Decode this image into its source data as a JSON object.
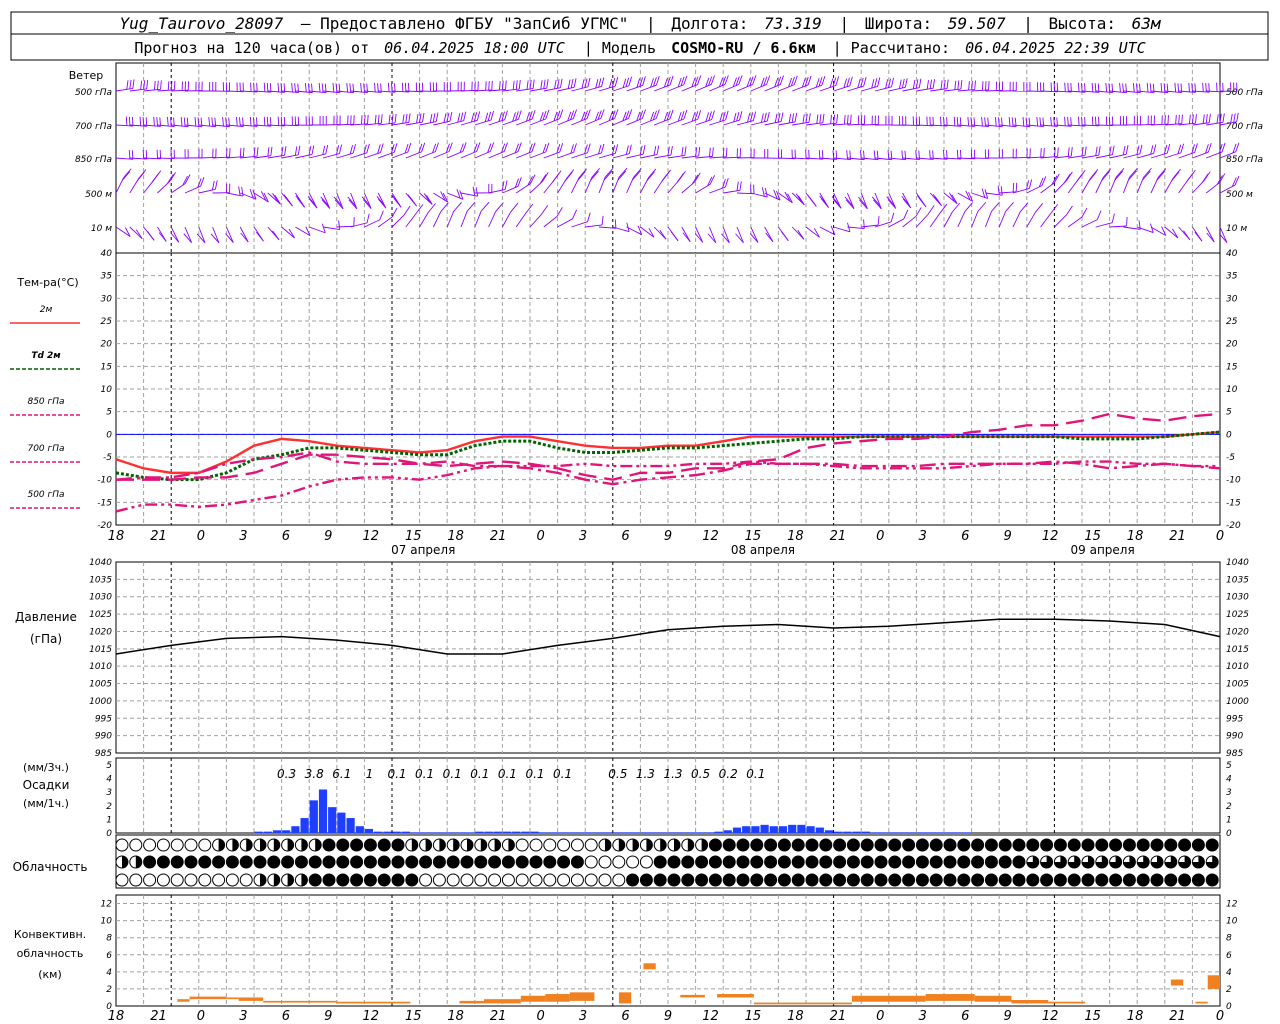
{
  "header": {
    "line1": {
      "station": "Yug_Taurovo_28097",
      "provider": "– Предоставлено ФГБУ \"ЗапСиб УГМС\"",
      "lon_label": "Долгота:",
      "lon": "73.319",
      "lat_label": "Широта:",
      "lat": "59.507",
      "alt_label": "Высота:",
      "alt": "63м"
    },
    "line2": {
      "forecast": "Прогноз на 120 часа(ов) от",
      "run_time": "06.04.2025 18:00 UTC",
      "model_label": "| Модель",
      "model": "COSMO-RU / 6.6км",
      "calc_label": "| Рассчитано:",
      "calc_time": "06.04.2025 22:39 UTC"
    }
  },
  "time_axis": {
    "tick_labels": [
      "18",
      "21",
      "0",
      "3",
      "6",
      "9",
      "12",
      "15",
      "18",
      "21",
      "0",
      "3",
      "6",
      "9",
      "12",
      "15",
      "18",
      "21",
      "0",
      "3",
      "6",
      "9",
      "12",
      "15",
      "18",
      "21",
      "0"
    ],
    "date_labels": [
      {
        "label": "07 апреля",
        "index": 8
      },
      {
        "label": "08 апреля",
        "index": 16
      },
      {
        "label": "09 апреля",
        "index": 24
      }
    ]
  },
  "colors": {
    "t2m": "#ff3030",
    "td2m": "#006400",
    "t850": "#e0157a",
    "wind": "#8b00ff",
    "pressure": "#000000",
    "precip": "#1f3fff",
    "convective": "#f08020",
    "grid": "#a0a0a0",
    "zero": "#0000ff"
  },
  "chart_data": [
    {
      "type": "barbs",
      "title": "Ветер",
      "levels": [
        "500 гПа",
        "700 гПа",
        "850 гПа",
        "500 м",
        "10 м"
      ],
      "note_levels_speed_level": [
        "strong",
        "strong",
        "moderate",
        "moderate",
        "light"
      ]
    },
    {
      "type": "line",
      "title": "Тем-ра(°C)",
      "ylim": [
        -20,
        40
      ],
      "yticks": [
        -20,
        -15,
        -10,
        -5,
        0,
        5,
        10,
        15,
        20,
        25,
        30,
        35,
        40
      ],
      "x_hours": [
        0,
        3,
        6,
        9,
        12,
        15,
        18,
        21,
        24,
        27,
        30,
        33,
        36,
        39,
        42,
        45,
        48,
        51,
        54,
        57,
        60,
        63,
        66,
        69,
        72,
        75,
        78,
        81,
        84,
        87,
        90,
        93,
        96,
        99,
        102,
        105,
        108,
        111,
        114,
        117,
        120
      ],
      "series": [
        {
          "name": "2м",
          "style": "solid",
          "values": [
            -5.5,
            -7.5,
            -8.5,
            -8.5,
            -6,
            -2.5,
            -1,
            -1.5,
            -2.5,
            -3,
            -3.5,
            -4,
            -3.5,
            -1.5,
            -0.5,
            -0.5,
            -1.5,
            -2.5,
            -3,
            -3,
            -2.5,
            -2.5,
            -1.5,
            -0.5,
            -0.5,
            -0.5,
            -0.5,
            -0.5,
            -0.5,
            -0.5,
            -0.5,
            -0.5,
            -0.5,
            -0.5,
            -0.5,
            -0.5,
            -0.5,
            -0.5,
            -0.5,
            0,
            0.5
          ]
        },
        {
          "name": "Td 2м",
          "style": "dotted",
          "values": [
            -8.5,
            -9.5,
            -10,
            -10,
            -8.5,
            -5.5,
            -4.5,
            -3,
            -3,
            -3.5,
            -4,
            -4.5,
            -4.5,
            -2.5,
            -1.5,
            -1.5,
            -3,
            -4,
            -4,
            -3.5,
            -3,
            -3,
            -2.5,
            -2,
            -1.5,
            -1,
            -1,
            -0.5,
            -0.5,
            -0.5,
            -0.5,
            -0.5,
            -0.5,
            -0.5,
            -0.5,
            -1,
            -1,
            -1,
            -0.5,
            0,
            0.5
          ]
        },
        {
          "name": "850 гПа",
          "style": "longdash",
          "values": [
            -10,
            -10,
            -10,
            -9.5,
            -9.5,
            -8.5,
            -6.5,
            -4.5,
            -4.5,
            -5,
            -5.5,
            -6.5,
            -7,
            -6.5,
            -6,
            -6.5,
            -7.5,
            -9,
            -10,
            -8.5,
            -8.5,
            -7.5,
            -7.5,
            -6,
            -5.5,
            -3,
            -2,
            -1.5,
            -1,
            -1,
            -0.5,
            0.5,
            1,
            2,
            2,
            3,
            4.5,
            3.5,
            3,
            4,
            4.5
          ]
        },
        {
          "name": "700 гПа",
          "style": "dashdot",
          "values": [
            -10,
            -9.5,
            -9.5,
            -8.5,
            -6.5,
            -5.5,
            -5,
            -4,
            -6,
            -6.5,
            -6.5,
            -6.5,
            -6,
            -7,
            -7,
            -7.5,
            -8.5,
            -10,
            -11,
            -10,
            -9.5,
            -9,
            -8,
            -6.5,
            -6.5,
            -6.5,
            -6.5,
            -7,
            -7,
            -7,
            -6.5,
            -6.5,
            -6.5,
            -6.5,
            -6,
            -6.5,
            -7.5,
            -7,
            -6.5,
            -7,
            -7.5
          ]
        },
        {
          "name": "500 гПа",
          "style": "dashdotdot",
          "values": [
            -17,
            -15.5,
            -15.5,
            -16,
            -15.5,
            -14.5,
            -13.5,
            -11.5,
            -10,
            -9.5,
            -9.5,
            -10,
            -9,
            -7.5,
            -7,
            -7,
            -7,
            -6.5,
            -7,
            -7,
            -7,
            -6.5,
            -6.5,
            -6,
            -6.5,
            -6.5,
            -7,
            -7.5,
            -7.5,
            -7.5,
            -7.5,
            -7,
            -6.5,
            -6.5,
            -6.5,
            -6,
            -6,
            -6.5,
            -6.5,
            -7,
            -7
          ]
        }
      ]
    },
    {
      "type": "line",
      "title": "Давление",
      "ylabel": "(гПа)",
      "ylim": [
        985,
        1040
      ],
      "yticks": [
        985,
        990,
        995,
        1000,
        1005,
        1010,
        1015,
        1020,
        1025,
        1030,
        1035,
        1040
      ],
      "x_hours": [
        0,
        6,
        12,
        18,
        24,
        30,
        36,
        42,
        48,
        54,
        60,
        66,
        72,
        78,
        84,
        90,
        96,
        102,
        108,
        114,
        120
      ],
      "values": [
        1013.5,
        1016,
        1018,
        1018.5,
        1017.5,
        1016,
        1013.5,
        1013.5,
        1016,
        1018,
        1020.5,
        1021.5,
        1022,
        1021,
        1021.5,
        1022.5,
        1023.5,
        1023.5,
        1023,
        1022,
        1018.5
      ]
    },
    {
      "type": "bar",
      "title": "Осадки",
      "ylabel_top": "(мм/3ч.)",
      "ylabel_bottom": "(мм/1ч.)",
      "ylim": [
        0,
        5
      ],
      "yticks": [
        0,
        1,
        2,
        3,
        4,
        5
      ],
      "labels_3h": [
        "0.3",
        "3.8",
        "6.1",
        "1",
        "0.1",
        "0.1",
        "0.1",
        "0.1",
        "0.1",
        "0.1",
        "0.1",
        "0.5",
        "1.3",
        "1.3",
        "0.5",
        "0.2",
        "0.1"
      ],
      "hourly_start_hour": 15,
      "hourly": [
        0.1,
        0.1,
        0.2,
        0.2,
        0.5,
        1.1,
        2.4,
        3.2,
        1.9,
        1.5,
        1.1,
        0.5,
        0.3,
        0.1,
        0.1,
        0.1,
        0.1,
        0.05,
        0.05,
        0.05,
        0.05,
        0.05,
        0.05,
        0.05,
        0.1,
        0.1,
        0.1,
        0.1,
        0.1,
        0.1,
        0.1,
        0.05,
        0.05,
        0.05,
        0.05,
        0.05,
        0.05,
        0.05,
        0.05,
        0.05,
        0.05,
        0.05,
        0.05,
        0.05,
        0.05,
        0.05,
        0.05,
        0.05,
        0.05,
        0.05,
        0.1,
        0.2,
        0.4,
        0.5,
        0.5,
        0.6,
        0.5,
        0.5,
        0.6,
        0.6,
        0.5,
        0.4,
        0.2,
        0.1,
        0.1,
        0.1,
        0.1,
        0.05,
        0.05,
        0.05,
        0.05,
        0.05,
        0.05,
        0.05,
        0.05,
        0.05,
        0.05,
        0.05
      ]
    },
    {
      "type": "table",
      "title": "Облачность",
      "rows": [
        "high",
        "middle",
        "low"
      ],
      "note": "cloud cover symbols 0-8 octas, 3-hourly columns"
    },
    {
      "type": "bar",
      "title": "Конвективн. облачность",
      "ylabel": "(км)",
      "ylim": [
        0,
        13
      ],
      "yticks": [
        0,
        2,
        4,
        6,
        8,
        10,
        12
      ],
      "segments": [
        {
          "from": 5,
          "to": 6,
          "bottom": 0.5,
          "top": 0.8
        },
        {
          "from": 6,
          "to": 9,
          "bottom": 0.8,
          "top": 1.1
        },
        {
          "from": 9,
          "to": 10,
          "bottom": 0.8,
          "top": 1.0
        },
        {
          "from": 10,
          "to": 12,
          "bottom": 0.6,
          "top": 1.0
        },
        {
          "from": 12,
          "to": 18,
          "bottom": 0.4,
          "top": 0.6
        },
        {
          "from": 18,
          "to": 24,
          "bottom": 0.3,
          "top": 0.5
        },
        {
          "from": 28,
          "to": 30,
          "bottom": 0.3,
          "top": 0.6
        },
        {
          "from": 30,
          "to": 33,
          "bottom": 0.3,
          "top": 0.8
        },
        {
          "from": 33,
          "to": 35,
          "bottom": 0.5,
          "top": 1.2
        },
        {
          "from": 35,
          "to": 37,
          "bottom": 0.5,
          "top": 1.4
        },
        {
          "from": 37,
          "to": 39,
          "bottom": 0.6,
          "top": 1.6
        },
        {
          "from": 41,
          "to": 42,
          "bottom": 0.3,
          "top": 1.6
        },
        {
          "from": 43,
          "to": 44,
          "bottom": 4.3,
          "top": 5.0
        },
        {
          "from": 46,
          "to": 48,
          "bottom": 1.0,
          "top": 1.3
        },
        {
          "from": 49,
          "to": 52,
          "bottom": 1.0,
          "top": 1.4
        },
        {
          "from": 52,
          "to": 60,
          "bottom": 0.2,
          "top": 0.4
        },
        {
          "from": 60,
          "to": 66,
          "bottom": 0.5,
          "top": 1.2
        },
        {
          "from": 66,
          "to": 70,
          "bottom": 0.6,
          "top": 1.4
        },
        {
          "from": 70,
          "to": 73,
          "bottom": 0.5,
          "top": 1.2
        },
        {
          "from": 73,
          "to": 76,
          "bottom": 0.3,
          "top": 0.7
        },
        {
          "from": 76,
          "to": 79,
          "bottom": 0.3,
          "top": 0.5
        },
        {
          "from": 86,
          "to": 87,
          "bottom": 2.4,
          "top": 3.1
        },
        {
          "from": 88,
          "to": 89,
          "bottom": 0.3,
          "top": 0.5
        },
        {
          "from": 89,
          "to": 90,
          "bottom": 2.0,
          "top": 3.6
        }
      ]
    }
  ]
}
